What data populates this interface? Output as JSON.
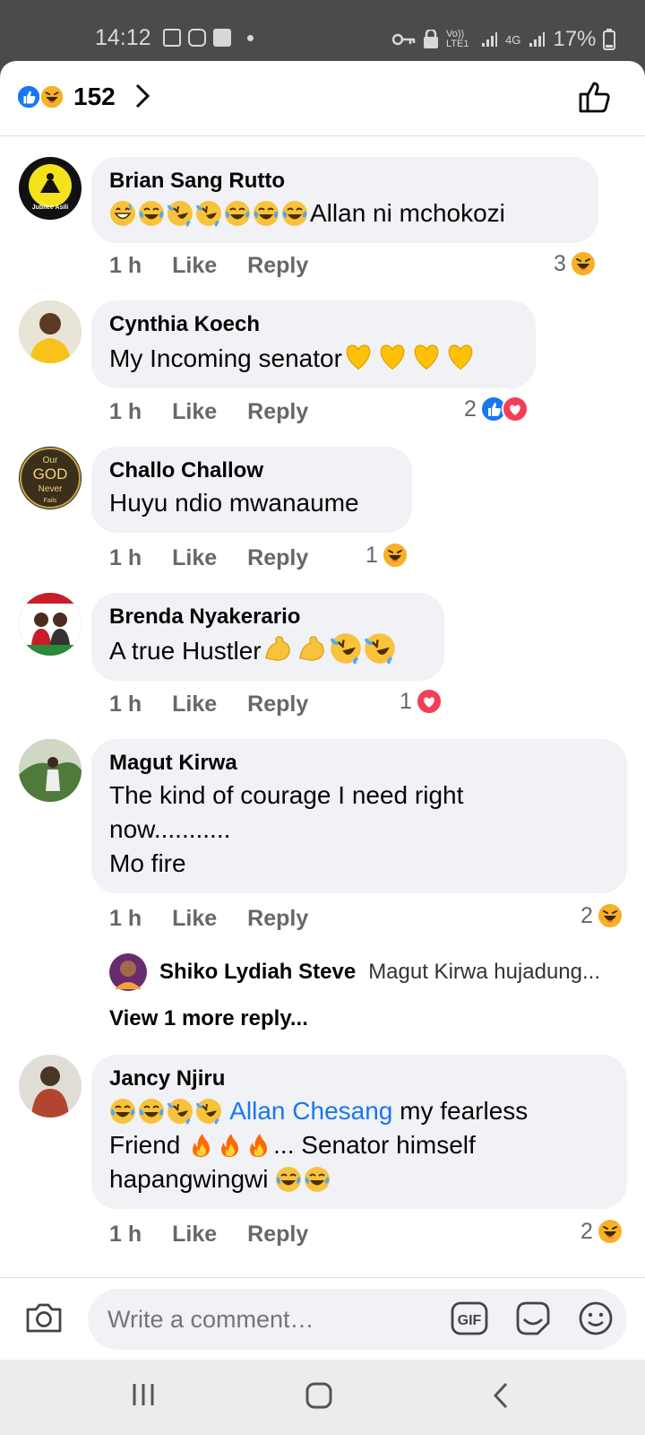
{
  "status_bar": {
    "time": "14:12",
    "battery": "17%",
    "network_1": "Vo)) LTE1",
    "network_2": "4G"
  },
  "header": {
    "reaction_count": "152"
  },
  "comments": [
    {
      "name": "Brian Sang Rutto",
      "text": "Allan ni mchokozi",
      "time": "1 h",
      "like": "Like",
      "reply": "Reply",
      "reactions": "3"
    },
    {
      "name": "Cynthia Koech",
      "text": "My Incoming senator",
      "time": "1 h",
      "like": "Like",
      "reply": "Reply",
      "reactions": "2"
    },
    {
      "name": "Challo Challow",
      "text": "Huyu ndio mwanaume",
      "time": "1 h",
      "like": "Like",
      "reply": "Reply",
      "reactions": "1"
    },
    {
      "name": "Brenda Nyakerario",
      "text": "A true Hustler",
      "time": "1 h",
      "like": "Like",
      "reply": "Reply",
      "reactions": "1"
    },
    {
      "name": "Magut Kirwa",
      "text_line1": "The kind of courage I need right",
      "text_line2": "now...........",
      "text_line3": "Mo fire",
      "time": "1 h",
      "like": "Like",
      "reply": "Reply",
      "reactions": "2",
      "reply_preview": {
        "name": "Shiko Lydiah Steve",
        "text": "Magut Kirwa hujadung..."
      },
      "more_replies": "View 1 more reply..."
    },
    {
      "name": "Jancy Njiru",
      "mention": "Allan Chesang",
      "text_after_mention": " my fearless",
      "text_line2a": "Friend ",
      "text_line2b": "... Senator himself",
      "text_line3": "hapangwingwi ",
      "time": "1 h",
      "like": "Like",
      "reply": "Reply",
      "reactions": "2"
    }
  ],
  "avatar_logos": {
    "brian": "Jubilee Asili",
    "challo_top": "Our",
    "challo_mid": "GOD",
    "challo_line3": "Never",
    "challo_line4": "Fails"
  },
  "composer": {
    "placeholder": "Write a comment…"
  },
  "colors": {
    "link": "#1877f2",
    "bubble": "#f0f2f5",
    "meta": "#65676b",
    "like_blue": "#1877f2",
    "heart_red": "#f33e58",
    "haha_yellow": "#f7b125"
  },
  "icons": [
    "like-reaction-icon",
    "haha-reaction-icon",
    "love-reaction-icon",
    "chevron-right-icon",
    "thumbs-up-outline-icon",
    "camera-icon",
    "gif-icon",
    "sticker-icon",
    "smiley-icon",
    "recents-icon",
    "home-icon",
    "back-icon"
  ]
}
